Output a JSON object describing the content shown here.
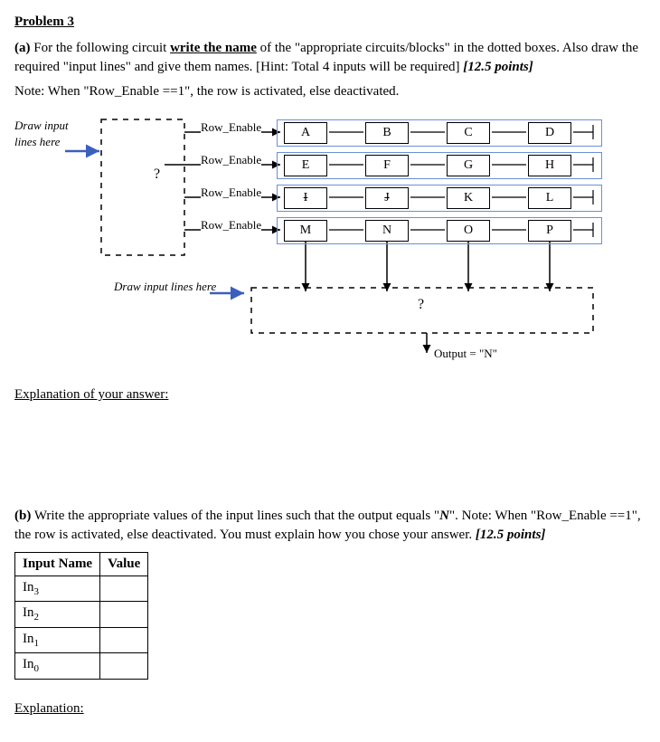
{
  "title": "Problem 3",
  "partA": {
    "label": "(a)",
    "text_before": "For the following circuit ",
    "write_name": "write the name",
    "text_mid": " of the \"appropriate circuits/blocks\" in the dotted boxes. Also draw the required \"input lines\" and give them names.  [Hint: Total 4 inputs will be required]       ",
    "points": "[12.5 points]",
    "note": "Note: When \"Row_Enable ==1\", the row is activated, else deactivated."
  },
  "diagram": {
    "draw_input_left": "Draw input\nlines here",
    "draw_input_bottom": "Draw input lines here",
    "row_enable_label": "Row_Enable",
    "grid": [
      [
        "A",
        "B",
        "C",
        "D"
      ],
      [
        "E",
        "F",
        "G",
        "H"
      ],
      [
        "I",
        "J",
        "K",
        "L"
      ],
      [
        "M",
        "N",
        "O",
        "P"
      ]
    ],
    "struck_cells": [
      "I",
      "J"
    ],
    "qmark": "?",
    "output_label": "Output = \"N\""
  },
  "explanation_a": "Explanation of your answer:",
  "partB": {
    "label": "(b)",
    "text_main": "Write the appropriate values of the input lines such that the output equals \"",
    "target_letter": "N",
    "text_after": "\".   Note: When \"Row_Enable ==1\", the row is activated, else deactivated. You must explain how you chose your answer.       ",
    "points": "[12.5 points]"
  },
  "table": {
    "h1": "Input Name",
    "h2": "Value",
    "rows": [
      "In",
      "In",
      "In",
      "In"
    ],
    "subs": [
      "3",
      "2",
      "1",
      "0"
    ]
  },
  "explanation_b": "Explanation:"
}
